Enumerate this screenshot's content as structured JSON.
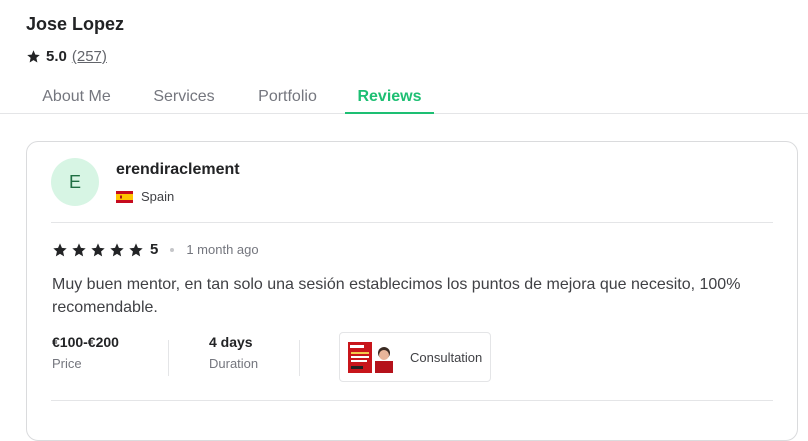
{
  "profile": {
    "name": "Jose Lopez",
    "rating": "5.0",
    "review_count": "(257)"
  },
  "tabs": [
    {
      "label": "About Me",
      "active": false
    },
    {
      "label": "Services",
      "active": false
    },
    {
      "label": "Portfolio",
      "active": false
    },
    {
      "label": "Reviews",
      "active": true
    }
  ],
  "review": {
    "avatar_initial": "E",
    "reviewer": "erendiraclement",
    "country": "Spain",
    "stars": 5,
    "score": "5",
    "time": "1 month ago",
    "text": "Muy buen mentor, en tan solo una sesión establecimos los puntos de mejora que necesito, 100% recomendable.",
    "price_value": "€100-€200",
    "price_label": "Price",
    "duration_value": "4 days",
    "duration_label": "Duration",
    "service_label": "Consultation"
  },
  "colors": {
    "accent": "#1dbf73",
    "avatar_bg": "#d7f5e4",
    "star": "#222325"
  },
  "icons": [
    "star-icon",
    "spain-flag-icon",
    "gig-thumbnail"
  ]
}
